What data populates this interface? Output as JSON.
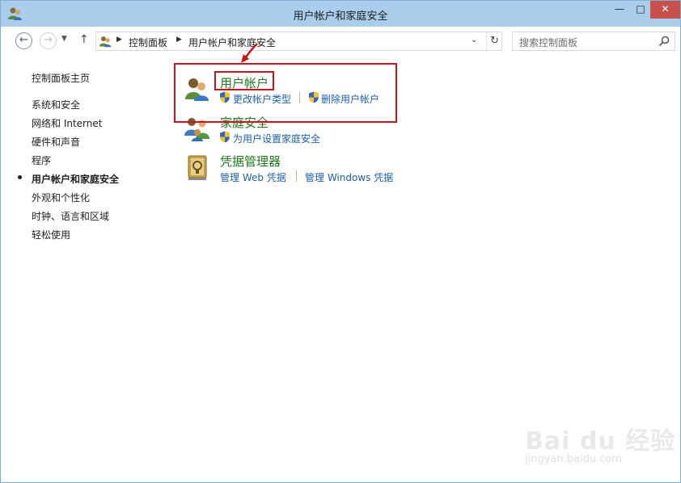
{
  "window": {
    "title": "用户帐户和家庭安全",
    "min_glyph": "—",
    "max_glyph": "□",
    "close_glyph": "✕"
  },
  "address": {
    "crumbs": [
      "控制面板",
      "用户帐户和家庭安全"
    ],
    "search_placeholder": "搜索控制面板"
  },
  "sidebar": {
    "home": "控制面板主页",
    "items": [
      "系统和安全",
      "网络和 Internet",
      "硬件和声音",
      "程序",
      "用户帐户和家庭安全",
      "外观和个性化",
      "时钟、语言和区域",
      "轻松使用"
    ],
    "current_index": 4
  },
  "categories": [
    {
      "title": "用户帐户",
      "links": [
        "更改帐户类型",
        "删除用户帐户"
      ]
    },
    {
      "title": "家庭安全",
      "links": [
        "为用户设置家庭安全"
      ]
    },
    {
      "title": "凭据管理器",
      "links": [
        "管理 Web 凭据",
        "管理 Windows 凭据"
      ]
    }
  ],
  "watermark": {
    "brand": "Bai du 经验",
    "url": "jingyan.baidu.com"
  },
  "colors": {
    "title_bar": "#a9cdeb",
    "category_title": "#1e7a1e",
    "link": "#1c5fa8",
    "highlight": "#c8151b",
    "close_button": "#c7504b"
  }
}
